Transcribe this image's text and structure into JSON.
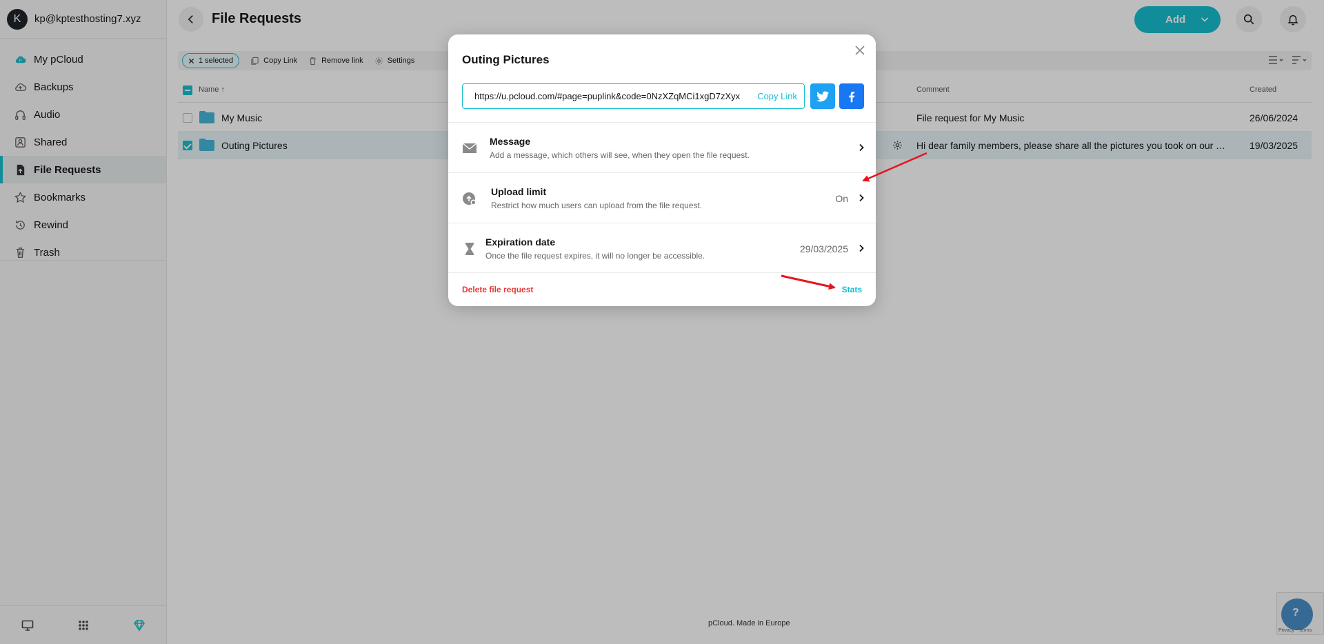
{
  "account": {
    "initial": "K",
    "email": "kp@kptesthosting7.xyz"
  },
  "sidebar": {
    "items": [
      {
        "label": "My pCloud",
        "icon": "cloud-icon"
      },
      {
        "label": "Backups",
        "icon": "backup-icon"
      },
      {
        "label": "Audio",
        "icon": "headphones-icon"
      },
      {
        "label": "Shared",
        "icon": "shared-icon"
      },
      {
        "label": "File Requests",
        "icon": "file-request-icon",
        "active": true
      },
      {
        "label": "Bookmarks",
        "icon": "star-icon"
      },
      {
        "label": "Rewind",
        "icon": "rewind-icon"
      },
      {
        "label": "Trash",
        "icon": "trash-icon"
      }
    ],
    "bottom_icons": [
      "desktop-icon",
      "apps-grid-icon",
      "diamond-icon"
    ]
  },
  "header": {
    "title": "File Requests",
    "add_label": "Add"
  },
  "toolbar": {
    "selected_label": "1 selected",
    "copy_link": "Copy Link",
    "remove_link": "Remove link",
    "settings": "Settings"
  },
  "table": {
    "columns": {
      "name": "Name",
      "comment": "Comment",
      "created": "Created"
    },
    "rows": [
      {
        "name": "My Music",
        "comment": "File request for My Music",
        "created": "26/06/2024",
        "selected": false
      },
      {
        "name": "Outing Pictures",
        "comment": "Hi dear family members, please share all the pictures you took on our Thailand trip",
        "created": "19/03/2025",
        "selected": true
      }
    ]
  },
  "footer": {
    "text": "pCloud. Made in Europe",
    "recaptcha": "Privacy - Terms"
  },
  "modal": {
    "title": "Outing Pictures",
    "link_url": "https://u.pcloud.com/#page=puplink&code=0NzXZqMCi1xgD7zXyx",
    "copy_link": "Copy Link",
    "options": {
      "message": {
        "title": "Message",
        "desc": "Add a message, which others will see, when they open the file request."
      },
      "upload_limit": {
        "title": "Upload limit",
        "desc": "Restrict how much users can upload from the file request.",
        "value": "On"
      },
      "expiration": {
        "title": "Expiration date",
        "desc": "Once the file request expires, it will no longer be accessible.",
        "value": "29/03/2025"
      }
    },
    "delete_label": "Delete file request",
    "stats_label": "Stats"
  },
  "colors": {
    "accent": "#17bed0",
    "danger": "#e83737",
    "annotation": "#e8141c"
  }
}
